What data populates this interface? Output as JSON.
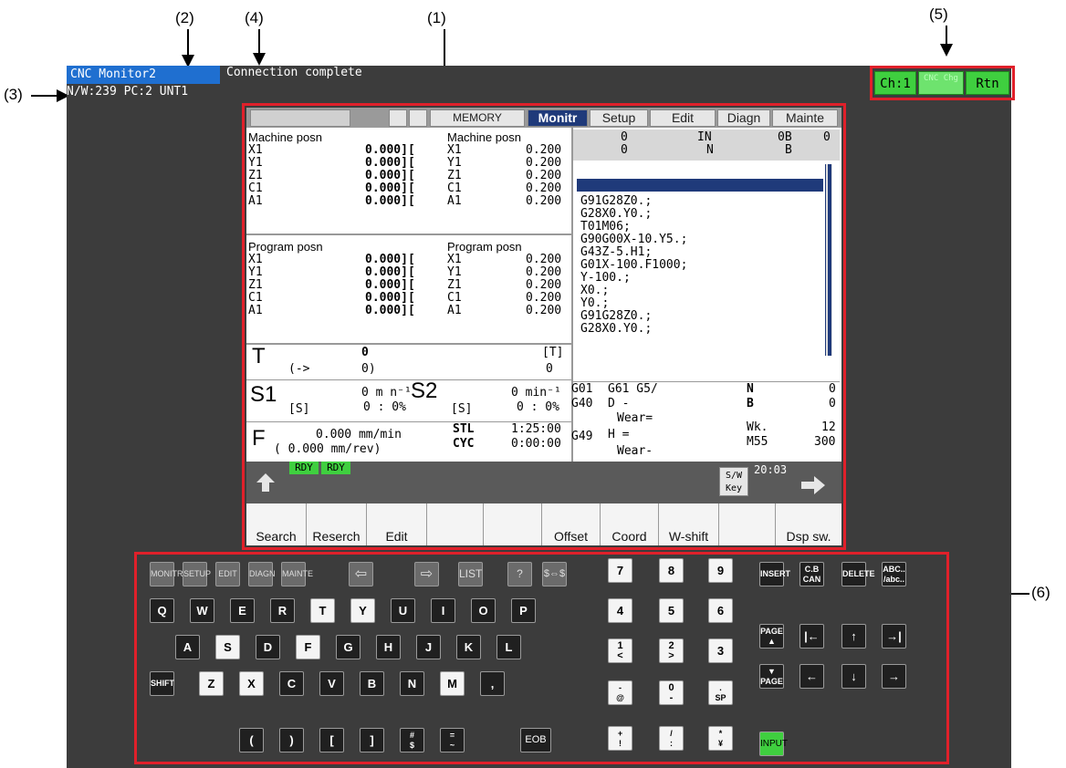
{
  "callouts": {
    "c1": "(1)",
    "c2": "(2)",
    "c3": "(3)",
    "c4": "(4)",
    "c5": "(5)",
    "c6": "(6)"
  },
  "header": {
    "title": "CNC Monitor2",
    "connection": "Connection complete",
    "info": "N/W:239 PC:2 UNT1",
    "buttons": {
      "ch": "Ch:1",
      "cnc_chg": "CNC Chg",
      "rtn": "Rtn"
    }
  },
  "screen": {
    "mode": "MEMORY",
    "tabs": [
      "Monitr",
      "Setup",
      "Edit",
      "Diagn",
      "Mainte"
    ],
    "machine_left": {
      "title": "Machine posn",
      "axes": [
        "X1",
        "Y1",
        "Z1",
        "C1",
        "A1"
      ],
      "values": [
        "0.000][",
        "0.000][",
        "0.000][",
        "0.000][",
        "0.000]["
      ]
    },
    "machine_right": {
      "title": "Machine posn",
      "axes": [
        "X1",
        "Y1",
        "Z1",
        "C1",
        "A1"
      ],
      "values": [
        "0.200",
        "0.200",
        "0.200",
        "0.200",
        "0.200"
      ]
    },
    "program_left": {
      "title": "Program posn",
      "axes": [
        "X1",
        "Y1",
        "Z1",
        "C1",
        "A1"
      ],
      "values": [
        "0.000][",
        "0.000][",
        "0.000][",
        "0.000][",
        "0.000]["
      ]
    },
    "program_right": {
      "title": "Program posn",
      "axes": [
        "X1",
        "Y1",
        "Z1",
        "C1",
        "A1"
      ],
      "values": [
        "0.200",
        "0.200",
        "0.200",
        "0.200",
        "0.200"
      ]
    },
    "top_right": {
      "r1a": "0",
      "r1b": "IN",
      "r1c": "0B",
      "r1d": "0",
      "r2a": "0",
      "r2b": "N",
      "r2c": "B"
    },
    "program": [
      "G91G28Z0.;",
      "G28X0.Y0.;",
      "T01M06;",
      "G90G00X-10.Y5.;",
      "G43Z-5.H1;",
      "G01X-100.F1000;",
      "Y-100.;",
      "X0.;",
      "Y0.;",
      "G91G28Z0.;",
      "G28X0.Y0.;"
    ],
    "t": {
      "label": "T",
      "val": "0",
      "arrow": "(->",
      "val2": "0)",
      "tb": "[T]",
      "tbv": "0"
    },
    "s1": {
      "label": "S1",
      "sub": "[S]",
      "rpm": "0 m n⁻¹",
      "pct": "0 :  0%"
    },
    "s2": {
      "label": "S2",
      "sub": "[S]",
      "rpm": "0 min⁻¹",
      "pct": "0 :  0%"
    },
    "f": {
      "label": "F",
      "mm_min": "0.000 mm/min",
      "mm_rev": "( 0.000   mm/rev)"
    },
    "stl": {
      "label": "STL",
      "val": "1:25:00"
    },
    "cyc": {
      "label": "CYC",
      "val": "0:00:00"
    },
    "modal": {
      "g1": "G01",
      "g2": "G61 G5/",
      "g3": "G40",
      "d": "D    -",
      "wear1": "Wear=",
      "g4": "G49",
      "h": "H    =",
      "wear2": "Wear-"
    },
    "counters": {
      "n": "N",
      "nv": "0",
      "b": "B",
      "bv": "0",
      "wk": "Wk.",
      "wkv": "12",
      "m": "M55",
      "mv": "300"
    },
    "rdy": "RDY",
    "rdy2": "RDY",
    "sw_key": "S/W Key",
    "clock": "20:03",
    "softkeys": [
      "Search",
      "Reserch",
      "Edit",
      "",
      "",
      "Offset",
      "Coord",
      "W-shift",
      "",
      "Dsp sw."
    ]
  },
  "keyboard": {
    "func": [
      "MONITR",
      "SETUP",
      "EDIT",
      "DIAGN",
      "MAINTE",
      "⇦",
      "⇨",
      "LIST",
      "?",
      "$⇔$"
    ],
    "row1": [
      "Q",
      "W",
      "E",
      "R",
      "T",
      "Y",
      "U",
      "I",
      "O",
      "P"
    ],
    "row2": [
      "A",
      "S",
      "D",
      "F",
      "G",
      "H",
      "J",
      "K",
      "L"
    ],
    "row3": [
      "SHIFT",
      "Z",
      "X",
      "C",
      "V",
      "B",
      "N",
      "M",
      ","
    ],
    "row4": [
      "(",
      ")",
      "[",
      "]",
      "#\n$",
      "=\n~",
      "EOB"
    ],
    "num1": [
      "7",
      "8",
      "9"
    ],
    "num2": [
      "4",
      "5",
      "6"
    ],
    "num3": [
      "1\n<",
      "2\n>",
      "3"
    ],
    "num4": [
      "-\n@",
      "0\n-",
      ".\nSP"
    ],
    "num5": [
      "+\n!",
      "/\n:",
      "*\n¥"
    ],
    "edit": [
      "INSERT",
      "C.B\nCAN",
      "DELETE",
      "ABC..\n/abc.."
    ],
    "nav": [
      "PAGE\n▲",
      "|←",
      "↑",
      "→|",
      "▼\nPAGE",
      "←",
      "↓",
      "→"
    ],
    "input": "INPUT"
  }
}
